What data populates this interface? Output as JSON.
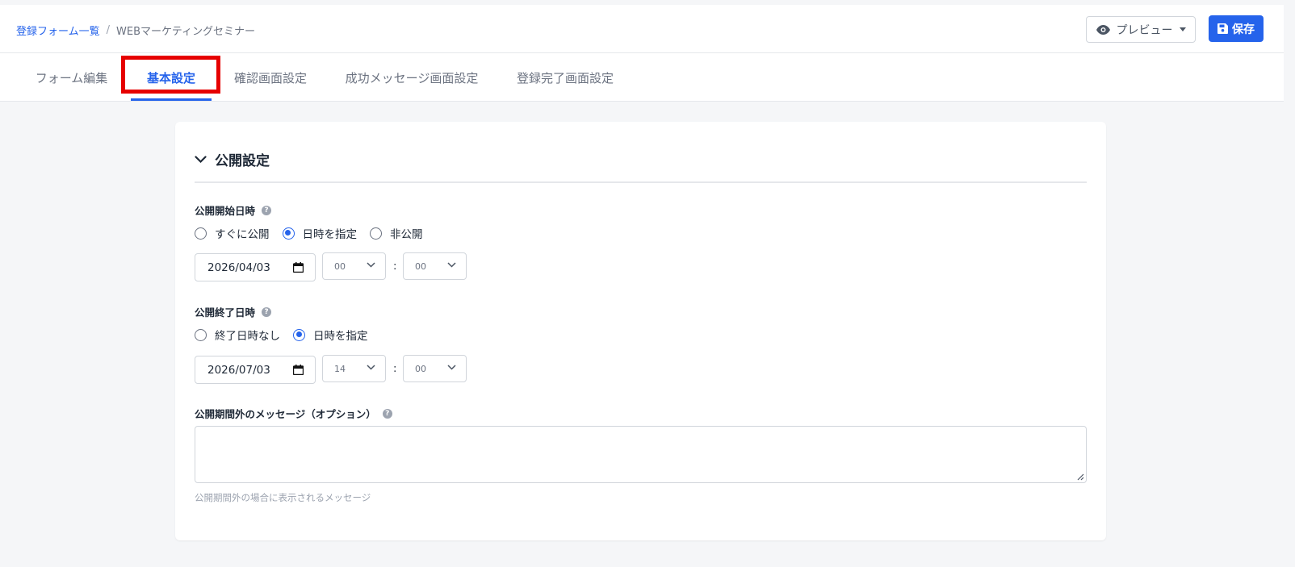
{
  "breadcrumb": {
    "parent": "登録フォーム一覧",
    "separator": "/",
    "current": "WEBマーケティングセミナー"
  },
  "header": {
    "preview_label": "プレビュー",
    "save_label": "保存"
  },
  "tabs": [
    {
      "label": "フォーム編集",
      "active": false
    },
    {
      "label": "基本設定",
      "active": true
    },
    {
      "label": "確認画面設定",
      "active": false
    },
    {
      "label": "成功メッセージ画面設定",
      "active": false
    },
    {
      "label": "登録完了画面設定",
      "active": false
    }
  ],
  "section": {
    "title": "公開設定",
    "start": {
      "label": "公開開始日時",
      "options": [
        "すぐに公開",
        "日時を指定",
        "非公開"
      ],
      "selected": "日時を指定",
      "date": "2026/04/03",
      "hour": "00",
      "minute": "00"
    },
    "end": {
      "label": "公開終了日時",
      "options": [
        "終了日時なし",
        "日時を指定"
      ],
      "selected": "日時を指定",
      "date": "2026/07/03",
      "hour": "14",
      "minute": "00"
    },
    "message": {
      "label": "公開期間外のメッセージ（オプション）",
      "value": "",
      "hint": "公開期間外の場合に表示されるメッセージ"
    },
    "time_separator": ":"
  },
  "colors": {
    "accent": "#2563eb",
    "highlight": "#e60000"
  }
}
